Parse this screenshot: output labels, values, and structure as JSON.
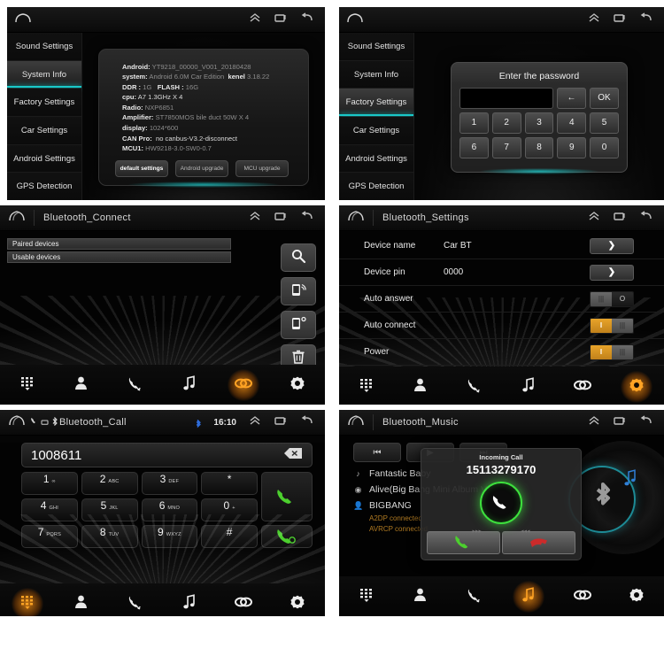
{
  "panels": {
    "system_info": {
      "titlebar": {
        "home_icon": "home-icon",
        "collapse_icon": "chevron-up-icon",
        "recents_icon": "recents-icon",
        "back_icon": "back-icon"
      },
      "sidebar": [
        {
          "label": "Sound Settings",
          "selected": false
        },
        {
          "label": "System Info",
          "selected": true
        },
        {
          "label": "Factory Settings",
          "selected": false
        },
        {
          "label": "Car Settings",
          "selected": false
        },
        {
          "label": "Android Settings",
          "selected": false
        },
        {
          "label": "GPS Detection",
          "selected": false
        }
      ],
      "info": [
        {
          "key": "Android:",
          "value": "YT9218_00000_V001_20180428"
        },
        {
          "key": "system:",
          "value": "Android 6.0M Car Edition",
          "key2": "kenel",
          "value2": "3.18.22"
        },
        {
          "key": "DDR :",
          "value": "1G",
          "key2": "FLASH :",
          "value2": "16G"
        },
        {
          "key": "cpu:",
          "value": "A7 1.3GHz X 4"
        },
        {
          "key": "Radio:",
          "value": "NXP6851"
        },
        {
          "key": "Amplifier:",
          "value": "ST7850MOS bile duct 50W X 4"
        },
        {
          "key": "display:",
          "value": "1024*600"
        },
        {
          "key": "CAN Pro:",
          "value": "no canbus-V3.2-disconnect",
          "lit": true
        },
        {
          "key": "MCU1:",
          "value": "HW9218-3.0-SW0-0.7"
        }
      ],
      "buttons": [
        {
          "label": "default settings",
          "active": true
        },
        {
          "label": "Android upgrade",
          "active": false
        },
        {
          "label": "MCU upgrade",
          "active": false
        }
      ]
    },
    "factory_password": {
      "sidebar": [
        {
          "label": "Sound Settings",
          "selected": false
        },
        {
          "label": "System Info",
          "selected": false
        },
        {
          "label": "Factory Settings",
          "selected": true
        },
        {
          "label": "Car Settings",
          "selected": false
        },
        {
          "label": "Android Settings",
          "selected": false
        },
        {
          "label": "GPS Detection",
          "selected": false
        }
      ],
      "dialog": {
        "title": "Enter the password",
        "input_value": "",
        "backspace_label": "←",
        "ok_label": "OK",
        "keys_row1": [
          "1",
          "2",
          "3",
          "4",
          "5"
        ],
        "keys_row2": [
          "6",
          "7",
          "8",
          "9",
          "0"
        ]
      }
    },
    "bluetooth_connect": {
      "title": "Bluetooth_Connect",
      "lists": [
        "Paired devices",
        "Usable devices"
      ],
      "tools": [
        {
          "name": "search-icon",
          "label": "Search"
        },
        {
          "name": "phone-pair-icon",
          "label": "Pair"
        },
        {
          "name": "phone-connect-icon",
          "label": "Connect"
        },
        {
          "name": "trash-icon",
          "label": "Delete"
        }
      ],
      "nav": [
        {
          "name": "dialpad-icon",
          "active": false
        },
        {
          "name": "contacts-icon",
          "active": false
        },
        {
          "name": "call-history-icon",
          "active": false
        },
        {
          "name": "music-icon",
          "active": false
        },
        {
          "name": "bluetooth-link-icon",
          "active": true
        },
        {
          "name": "settings-gear-icon",
          "active": false
        }
      ]
    },
    "bluetooth_settings": {
      "title": "Bluetooth_Settings",
      "rows": [
        {
          "label": "Device name",
          "value": "Car BT",
          "control": "arrow",
          "arrow_label": "❯"
        },
        {
          "label": "Device pin",
          "value": "0000",
          "control": "arrow",
          "arrow_label": "❯"
        },
        {
          "label": "Auto answer",
          "value": "",
          "control": "toggle",
          "state": "off"
        },
        {
          "label": "Auto connect",
          "value": "",
          "control": "toggle",
          "state": "on"
        },
        {
          "label": "Power",
          "value": "",
          "control": "toggle",
          "state": "on"
        }
      ],
      "toggle_on_label": "I",
      "toggle_off_label": "O",
      "nav": [
        {
          "name": "dialpad-icon",
          "active": false
        },
        {
          "name": "contacts-icon",
          "active": false
        },
        {
          "name": "call-history-icon",
          "active": false
        },
        {
          "name": "music-icon",
          "active": false
        },
        {
          "name": "bluetooth-link-icon",
          "active": false
        },
        {
          "name": "settings-gear-icon",
          "active": true
        }
      ]
    },
    "bluetooth_call": {
      "title": "Bluetooth_Call",
      "status": {
        "time": "16:10",
        "bluetooth_icon": "bluetooth-icon",
        "phone_icon": "phone-icon",
        "sim_icon": "sim-icon"
      },
      "number": "1008611",
      "backspace_icon": "backspace-icon",
      "keys": [
        {
          "big": "1",
          "sub": "∞"
        },
        {
          "big": "2",
          "sub": "ABC"
        },
        {
          "big": "3",
          "sub": "DEF"
        },
        {
          "big": "*",
          "sub": ""
        },
        {
          "big": "4",
          "sub": "GHI"
        },
        {
          "big": "5",
          "sub": "JKL"
        },
        {
          "big": "6",
          "sub": "MNO"
        },
        {
          "big": "0",
          "sub": "+"
        },
        {
          "big": "7",
          "sub": "PQRS"
        },
        {
          "big": "8",
          "sub": "TUV"
        },
        {
          "big": "9",
          "sub": "WXYZ"
        },
        {
          "big": "#",
          "sub": ""
        }
      ],
      "answer_icon": "call-answer-icon",
      "end_icon": "call-end-icon",
      "nav": [
        {
          "name": "dialpad-icon",
          "active": true
        },
        {
          "name": "contacts-icon",
          "active": false
        },
        {
          "name": "call-history-icon",
          "active": false
        },
        {
          "name": "music-icon",
          "active": false
        },
        {
          "name": "bluetooth-link-icon",
          "active": false
        },
        {
          "name": "settings-gear-icon",
          "active": false
        }
      ]
    },
    "bluetooth_music": {
      "title": "Bluetooth_Music",
      "controls": [
        {
          "name": "previous-track-icon",
          "label": "⏮"
        },
        {
          "name": "play-icon",
          "label": "▶"
        },
        {
          "name": "next-track-icon",
          "label": "⏭"
        }
      ],
      "track": {
        "title": "Fantastic Baby",
        "album": "Alive(Big Bang Mini Album Vol...",
        "artist": "BIGBANG"
      },
      "status_lines": [
        "A2DP connected",
        "AVRCP connected"
      ],
      "incoming_call": {
        "title": "Incoming Call",
        "number": "15113279170",
        "answer_icon": "call-answer-icon",
        "reject_icon": "call-end-icon"
      },
      "nav": [
        {
          "name": "dialpad-icon",
          "active": false
        },
        {
          "name": "contacts-icon",
          "active": false
        },
        {
          "name": "call-history-icon",
          "active": false
        },
        {
          "name": "music-icon",
          "active": true
        },
        {
          "name": "bluetooth-link-icon",
          "active": false
        },
        {
          "name": "settings-gear-icon",
          "active": false
        }
      ]
    }
  },
  "colors": {
    "accent_teal": "#19c8c8",
    "accent_orange": "#e8a42a",
    "call_green": "#3de03d",
    "call_red": "#d03030"
  }
}
